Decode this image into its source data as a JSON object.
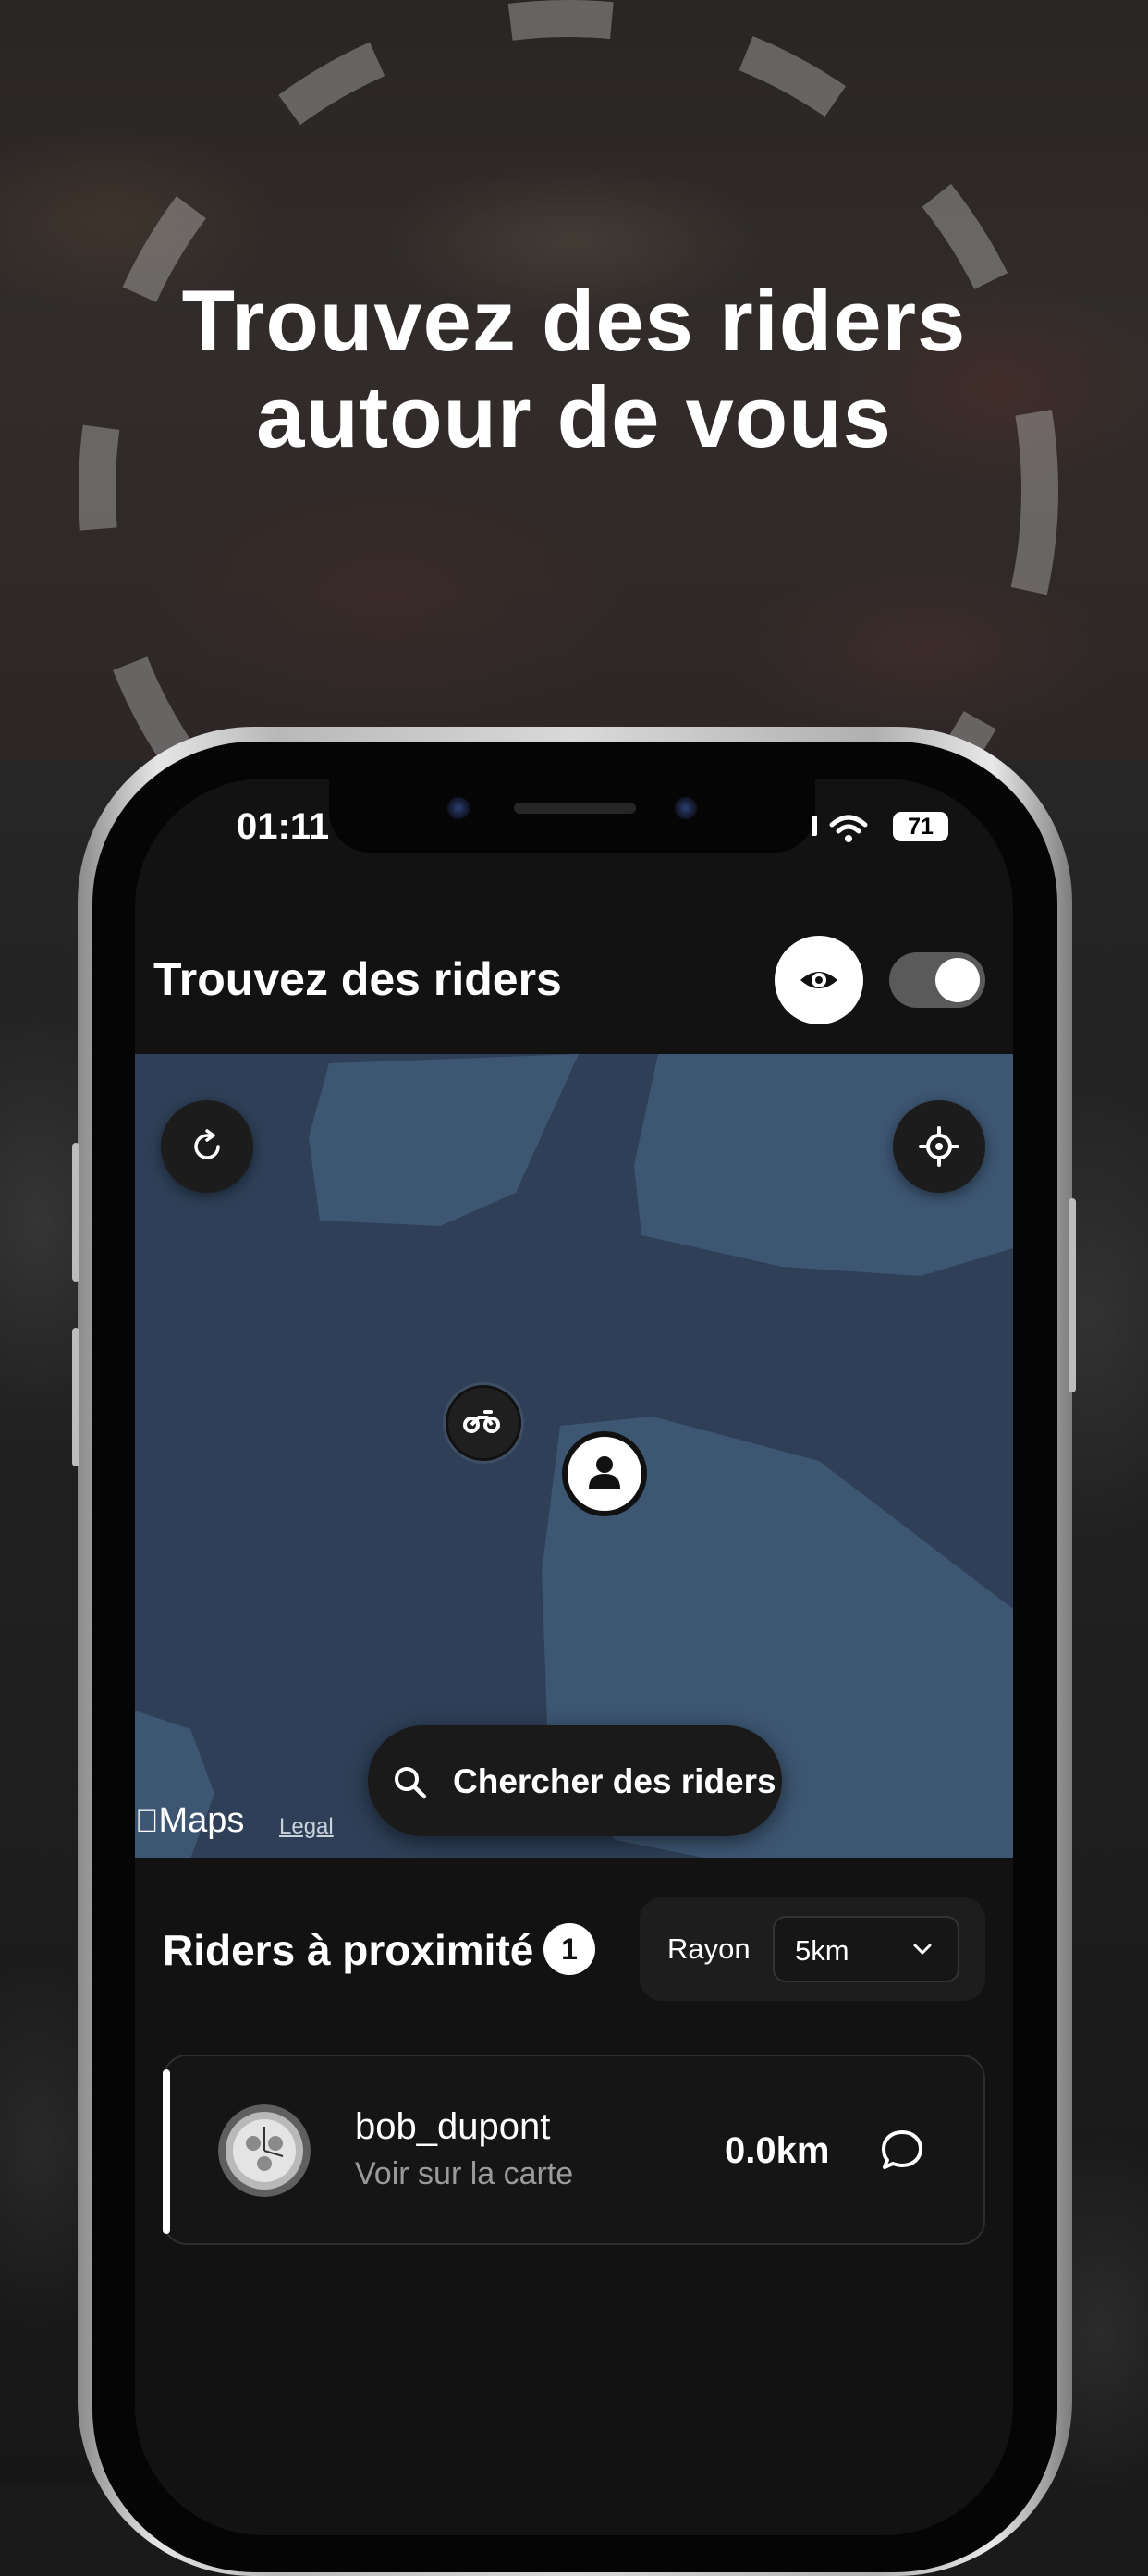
{
  "promo": {
    "headline_line1": "Trouvez des riders",
    "headline_line2": "autour de vous"
  },
  "status_bar": {
    "time": "01:11",
    "battery": "71"
  },
  "header": {
    "title": "Trouvez des riders",
    "visibility_icon": "eye-icon",
    "visibility_toggle_on": true
  },
  "map": {
    "refresh_icon": "refresh-icon",
    "locate_icon": "crosshair-icon",
    "search_button_label": "Chercher des riders",
    "attribution": "Maps",
    "legal_label": "Legal",
    "rider_pin_icon": "motorcycle-icon",
    "user_pin_icon": "user-icon"
  },
  "nearby": {
    "title": "Riders à proximité",
    "count": "1",
    "radius_label": "Rayon",
    "radius_value": "5km",
    "riders": [
      {
        "username": "bob_dupont",
        "subtitle": "Voir sur la carte",
        "distance": "0.0km"
      }
    ]
  },
  "colors": {
    "map_water": "#2e3f57",
    "map_land": "#3d5672",
    "screen_bg": "#121212",
    "accent": "#ffffff"
  }
}
